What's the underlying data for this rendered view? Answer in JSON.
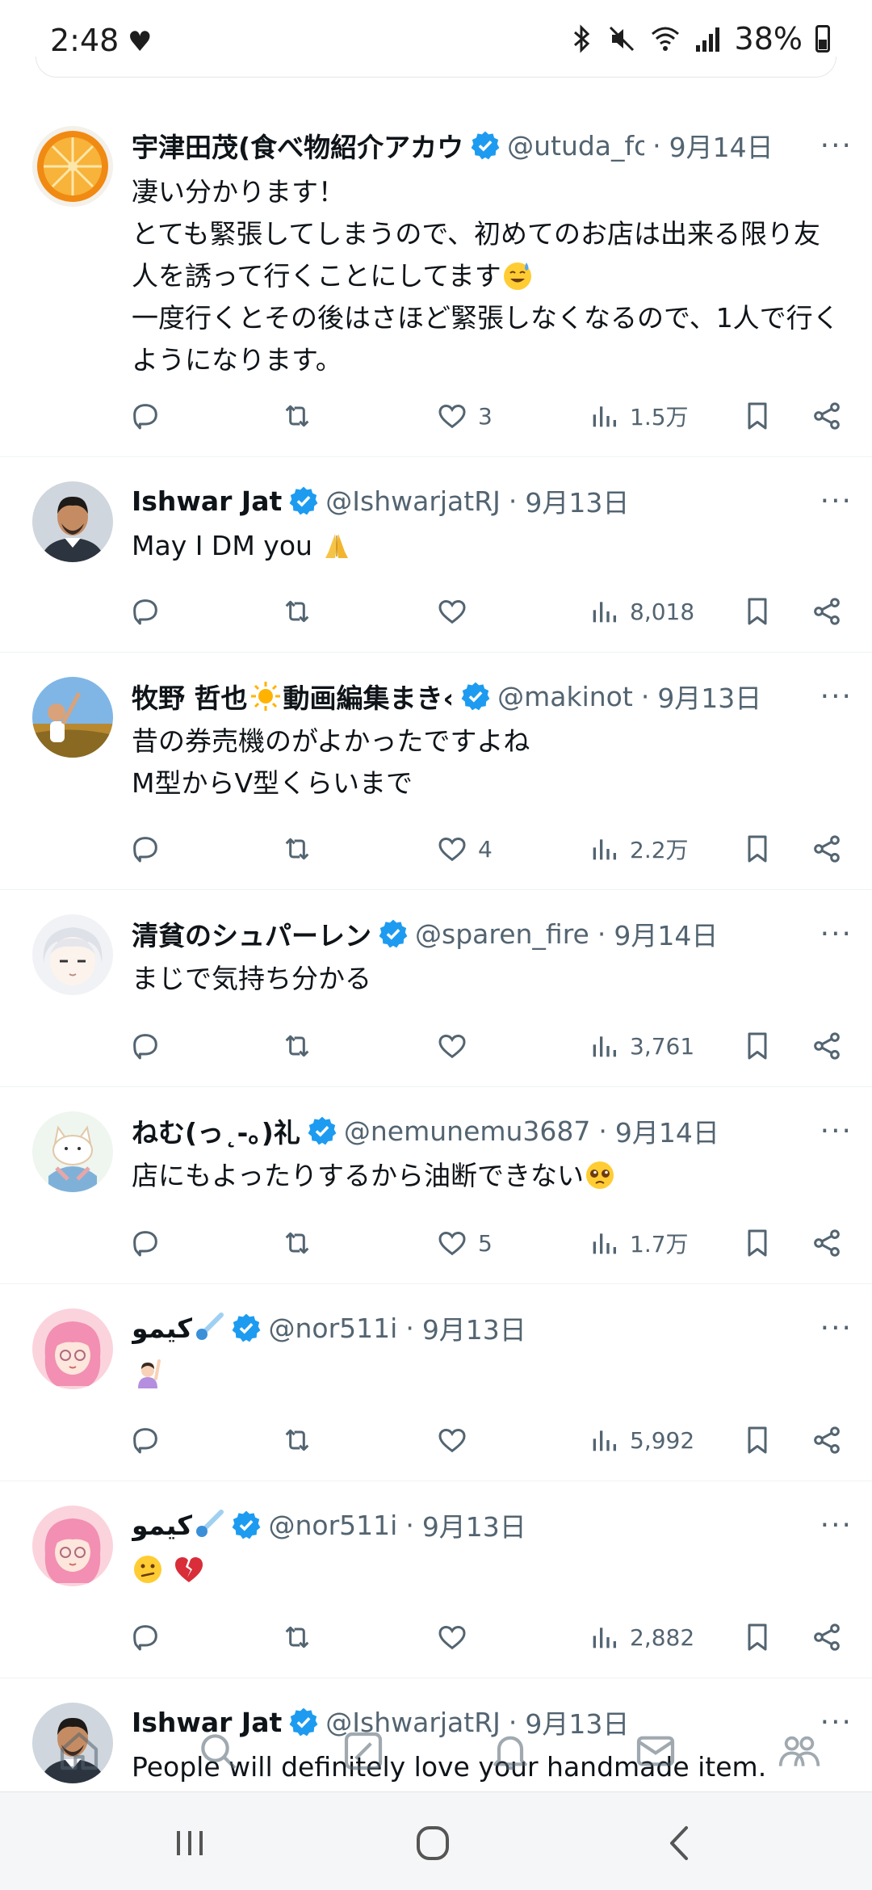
{
  "status_bar": {
    "time": "2:48",
    "battery": "38%",
    "icons": [
      "heart-icon",
      "bluetooth-icon",
      "mute-icon",
      "wifi-icon",
      "signal-icon",
      "battery-icon"
    ]
  },
  "tweets": [
    {
      "name": "宇津田茂(食べ物紹介アカウ",
      "handle": "@utuda_fo",
      "date": "9月14日",
      "text": "凄い分かります！\nとても緊張してしまうので、初めてのお店は出来る限り友人を誘って行くことにしてます",
      "text_after_emoji": "\n一度行くとその後はさほど緊張しなくなるので、1人で行くようになります。",
      "likes": "3",
      "views": "1.5万"
    },
    {
      "name": "Ishwar Jat",
      "handle": "@IshwarjatRJ",
      "date": "9月13日",
      "text": "May I DM you",
      "likes": "",
      "views": "8,018"
    },
    {
      "name": "牧野 哲也",
      "name_suffix": "動画編集まき‹",
      "handle": "@makinot",
      "date": "9月13日",
      "text": "昔の券売機のがよかったですよね\nM型からV型くらいまで",
      "likes": "4",
      "views": "2.2万"
    },
    {
      "name": "清貧のシュパーレン",
      "handle": "@sparen_fire",
      "date": "9月14日",
      "text": "まじで気持ち分かる",
      "likes": "",
      "views": "3,761"
    },
    {
      "name": "ねむ(っ˛-。)礼",
      "handle": "@nemunemu3687",
      "date": "9月14日",
      "text": "店にもよったりするから油断できない",
      "likes": "5",
      "views": "1.7万"
    },
    {
      "name": "كيمو",
      "handle": "@nor511i",
      "date": "9月13日",
      "text": "",
      "likes": "",
      "views": "5,992"
    },
    {
      "name": "كيمو",
      "handle": "@nor511i",
      "date": "9月13日",
      "text": "",
      "likes": "",
      "views": "2,882"
    },
    {
      "name": "Ishwar Jat",
      "handle": "@IshwarjatRJ",
      "date": "9月13日",
      "text": "People will definitely love your handmade item."
    }
  ],
  "common": {
    "dot": "·",
    "more": "···"
  },
  "bottom_nav": [
    "home-icon",
    "search-icon",
    "grok-icon",
    "notifications-icon",
    "messages-icon",
    "communities-icon"
  ],
  "colors": {
    "text": "#0f1419",
    "secondary": "#536471",
    "verified": "#1d9bf0",
    "divider": "#eff3f4"
  }
}
